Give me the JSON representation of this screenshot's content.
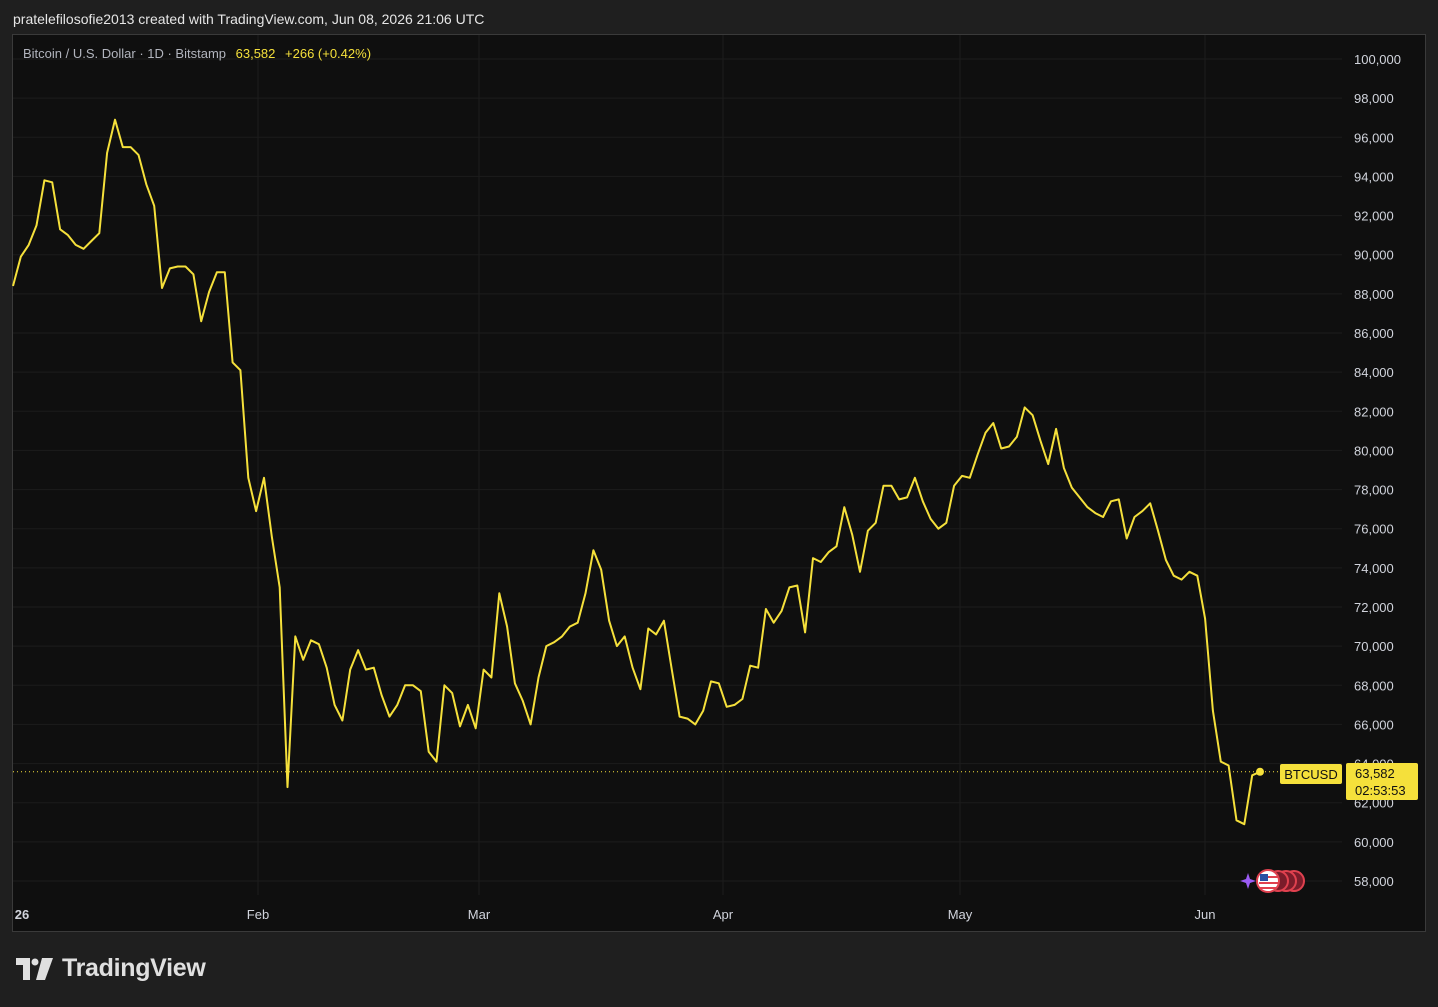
{
  "header": {
    "text": "pratelefilosofie2013 created with TradingView.com, Jun 08, 2026 21:06 UTC"
  },
  "legend": {
    "symbol": "Bitcoin / U.S. Dollar · 1D · Bitstamp",
    "price": "63,582",
    "change": "+266 (+0.42%)"
  },
  "price_label": {
    "ticker": "BTCUSD",
    "price": "63,582",
    "countdown": "02:53:53"
  },
  "footer": {
    "brand": "TradingView"
  },
  "colors": {
    "line": "#f5e03b",
    "background": "#0f0f0f",
    "grid": "#1c1c1c",
    "axis_text": "#d1d4dc"
  },
  "chart_data": {
    "type": "line",
    "series": [
      {
        "values": [
          88400,
          89900,
          90500,
          91500,
          93800,
          93700,
          91300,
          91000,
          90500,
          90300,
          90700,
          91100,
          95200,
          96900,
          95500,
          95500,
          95100,
          93600,
          92500,
          88300,
          89300,
          89400,
          89400,
          89000,
          86600,
          88100,
          89100,
          89100,
          84500,
          84100,
          78600,
          76900,
          78600,
          75600,
          73000,
          62800,
          70500,
          69300,
          70300,
          70100,
          68900,
          67000,
          66200,
          68800,
          69800,
          68800,
          68900,
          67500,
          66400,
          67000,
          68000,
          68000,
          67700,
          64600,
          64100,
          68000,
          67600,
          65900,
          67000,
          65800,
          68800,
          68400,
          72700,
          71000,
          68100,
          67200,
          66000,
          68400,
          70000,
          70200,
          70500,
          71000,
          71200,
          72700,
          74900,
          73900,
          71300,
          70000,
          70500,
          68900,
          67800,
          70900,
          70600,
          71300,
          68800,
          66400,
          66300,
          66000,
          66700,
          68200,
          68100,
          66900,
          67000,
          67300,
          69000,
          68900,
          71900,
          71200,
          71800,
          73000,
          73100,
          70700,
          74500,
          74300,
          74800,
          75100,
          77100,
          75700,
          73800,
          75900,
          76300,
          78200,
          78200,
          77500,
          77600,
          78600,
          77400,
          76500,
          76000,
          76300,
          78200,
          78700,
          78600,
          79800,
          80900,
          81400,
          80100,
          80200,
          80700,
          82200,
          81800,
          80500,
          79300,
          81100,
          79100,
          78100,
          77600,
          77100,
          76800,
          76600,
          77400,
          77500,
          75500,
          76600,
          76900,
          77300,
          75900,
          74400,
          73600,
          73400,
          73800,
          73600,
          71400,
          66700,
          64100,
          63900,
          61100,
          60900,
          63400,
          63582
        ]
      }
    ],
    "x_labels": [
      "26",
      "Feb",
      "Mar",
      "Apr",
      "May",
      "Jun"
    ],
    "y_ticks": [
      58000,
      60000,
      62000,
      64000,
      66000,
      68000,
      70000,
      72000,
      74000,
      76000,
      78000,
      80000,
      82000,
      84000,
      86000,
      88000,
      90000,
      92000,
      94000,
      96000,
      98000,
      100000
    ],
    "ylim": [
      56800,
      101200
    ],
    "last_value": 63582,
    "grid": true
  }
}
